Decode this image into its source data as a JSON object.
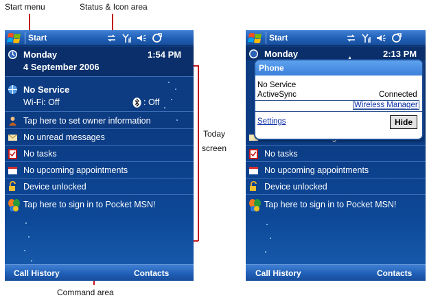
{
  "annotations": {
    "start_menu": "Start menu",
    "status_icon_area": "Status & Icon area",
    "today_screen_1": "Today",
    "today_screen_2": "screen",
    "command_area": "Command area"
  },
  "left_screen": {
    "start_label": "Start",
    "date_day": "Monday",
    "date_full": "4 September 2006",
    "time": "1:54 PM",
    "network_title": "No Service",
    "wifi_status": "Wi-Fi: Off",
    "bluetooth_status": ": Off",
    "owner_info": "Tap here to set owner information",
    "messages": "No unread messages",
    "tasks": "No tasks",
    "appointments": "No upcoming appointments",
    "device_lock": "Device unlocked",
    "msn": "Tap here to sign in to Pocket MSN!",
    "softkey_left": "Call History",
    "softkey_right": "Contacts"
  },
  "right_screen": {
    "start_label": "Start",
    "date_day_partial": "Monday",
    "time_partial": "2:13 PM",
    "messages_partial": "No unread messages",
    "tasks": "No tasks",
    "appointments": "No upcoming appointments",
    "device_lock": "Device unlocked",
    "msn": "Tap here to sign in to Pocket MSN!",
    "softkey_left": "Call History",
    "softkey_right": "Contacts",
    "popup": {
      "title": "Phone",
      "status_line": "No Service",
      "activesync_label": "ActiveSync",
      "activesync_value": "Connected",
      "wireless_manager_link": "Wireless Manager",
      "settings_link": "Settings",
      "hide_button": "Hide"
    }
  },
  "icons": {
    "start": "windows-flag-icon",
    "connectivity": "sync-arrows-icon",
    "signal": "antenna-icon",
    "volume": "speaker-icon",
    "battery": "battery-plug-icon",
    "calendar_clock": "clock-icon",
    "network": "globe-icon",
    "owner": "person-icon",
    "messages": "envelope-icon",
    "tasks": "checkbox-icon",
    "appointments": "calendar-icon",
    "lock": "padlock-icon",
    "msn": "msn-butterfly-icon",
    "bluetooth": "bluetooth-icon"
  },
  "colors": {
    "callout_line": "#c0161b",
    "titlebar": "#1f5fb6",
    "today_background": "#0c3b82",
    "popup_header": "#3b7fd9"
  }
}
